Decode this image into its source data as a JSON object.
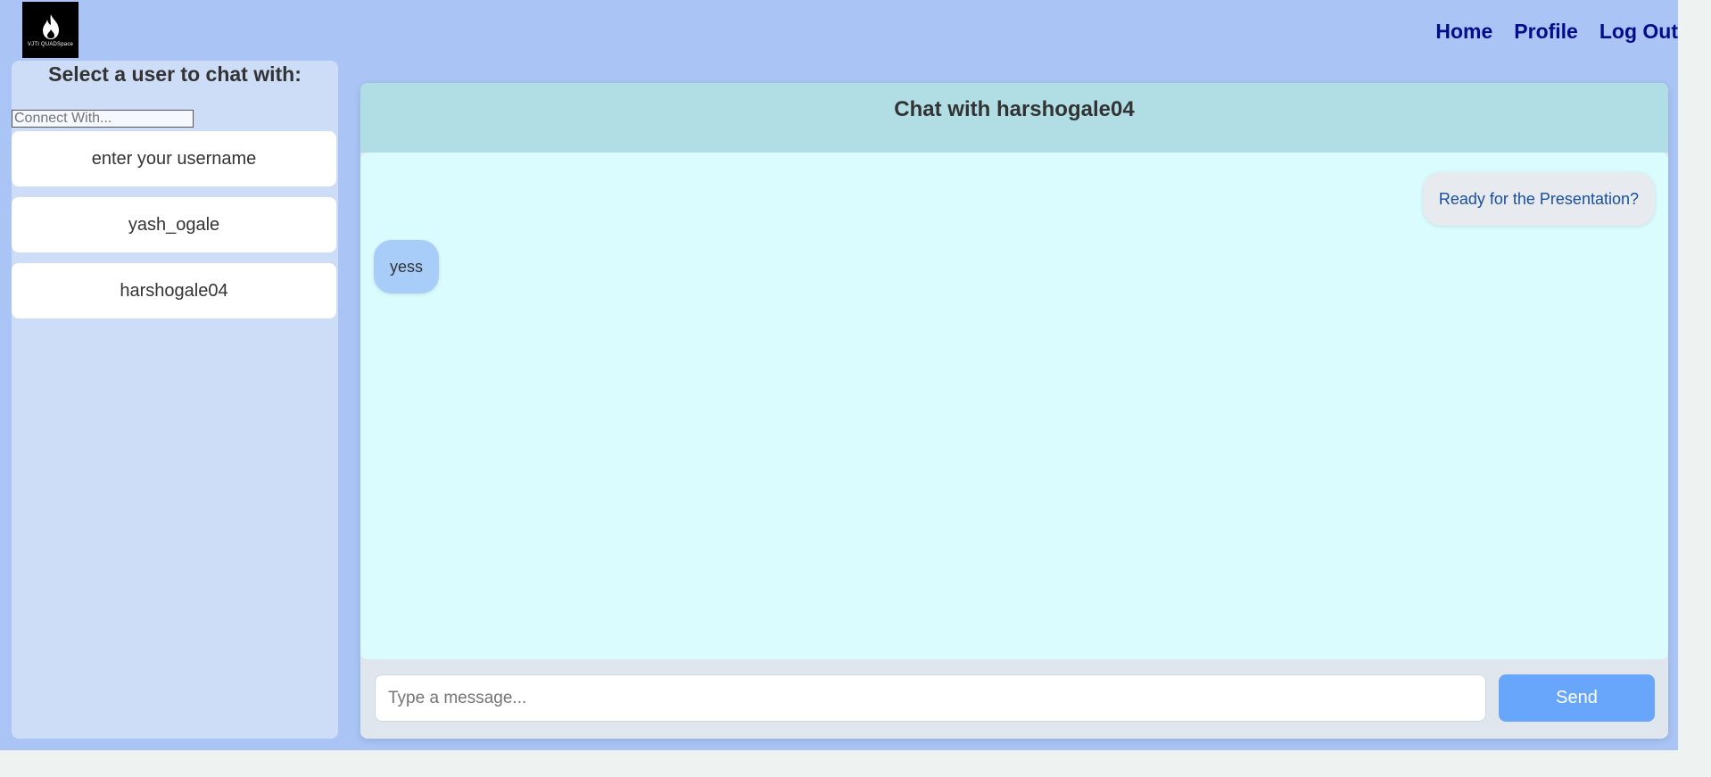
{
  "logo": {
    "text": "VJTI QUADSpace",
    "icon": "flame-icon"
  },
  "nav": {
    "home": "Home",
    "profile": "Profile",
    "logout": "Log Out"
  },
  "sidebar": {
    "title": "Select a user to chat with:",
    "search_placeholder": "Connect With...",
    "users": [
      {
        "label": "enter your username"
      },
      {
        "label": "yash_ogale"
      },
      {
        "label": "harshogale04"
      }
    ]
  },
  "chat": {
    "title": "Chat with harshogale04",
    "messages": [
      {
        "direction": "sent",
        "text": "Ready for the Presentation?"
      },
      {
        "direction": "received",
        "text": "yess"
      }
    ],
    "input_placeholder": "Type a message...",
    "send_label": "Send"
  },
  "colors": {
    "page_bg": "#a9c4f5",
    "sidebar_bg": "#cddcf7",
    "chat_header_bg": "#b1dee5",
    "chat_messages_bg": "#dbfcfe",
    "nav_link": "#000c8a",
    "send_button": "#68a6fb",
    "received_bubble": "#a9cdf9",
    "sent_bubble": "#e7eaee"
  }
}
